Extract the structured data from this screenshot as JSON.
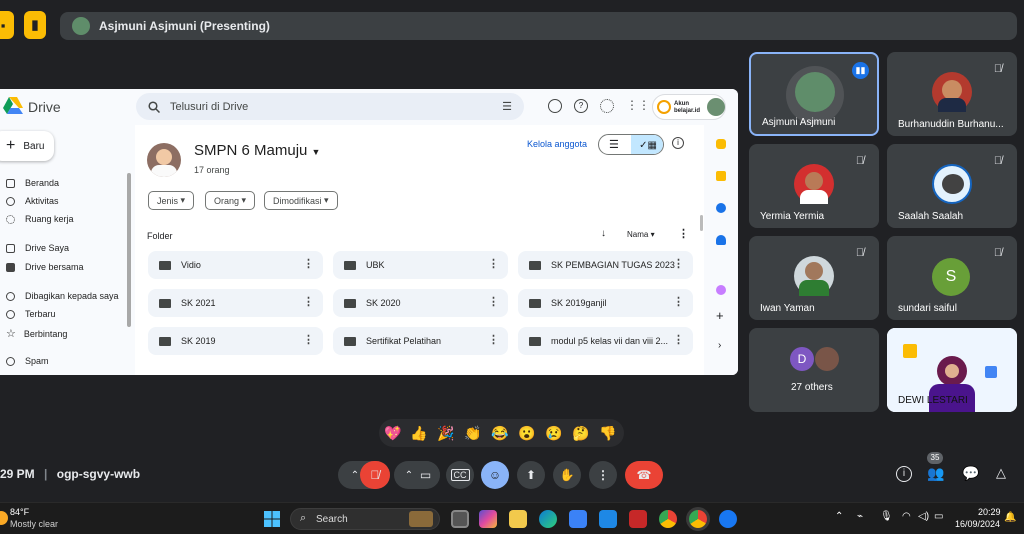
{
  "presenting_bar": {
    "text": "Asjmuni Asjmuni (Presenting)"
  },
  "drive": {
    "logo_text": "Drive",
    "search_placeholder": "Telusuri di Drive",
    "account_label": "Akun belajar.id",
    "new_button": "Baru",
    "nav": [
      "Beranda",
      "Aktivitas",
      "Ruang kerja",
      "Drive Saya",
      "Drive bersama",
      "Dibagikan kepada saya",
      "Terbaru",
      "Berbintang",
      "Spam"
    ],
    "drive_name": "SMPN 6 Mamuju",
    "members": "17 orang",
    "manage_members": "Kelola anggota",
    "filters": [
      "Jenis",
      "Orang",
      "Dimodifikasi"
    ],
    "section": "Folder",
    "sort_label": "Nama",
    "folders": [
      "Vidio",
      "UBK",
      "SK PEMBAGIAN TUGAS 2023",
      "SK 2021",
      "SK 2020",
      "SK 2019ganjil",
      "SK 2019",
      "Sertifikat Pelatihan",
      "modul p5 kelas vii dan viii 2..."
    ]
  },
  "participants": [
    {
      "name": "Asjmuni Asjmuni",
      "speaking": true
    },
    {
      "name": "Burhanuddin Burhanu...",
      "muted": true
    },
    {
      "name": "Yermia Yermia",
      "muted": true
    },
    {
      "name": "Saalah Saalah",
      "muted": true
    },
    {
      "name": "Iwan Yaman",
      "muted": true
    },
    {
      "name": "sundari saiful",
      "muted": true,
      "initial": "S"
    },
    {
      "name": "27 others",
      "initial": "D"
    },
    {
      "name": "DEWI LESTARI"
    }
  ],
  "reactions": [
    "💖",
    "👍",
    "🎉",
    "👏",
    "😂",
    "😮",
    "😢",
    "🤔",
    "👎"
  ],
  "meeting": {
    "time": "29 PM",
    "code": "ogp-sgvy-wwb",
    "participant_count": "35"
  },
  "taskbar": {
    "weather_temp": "84°F",
    "weather_desc": "Mostly clear",
    "search": "Search",
    "clock_time": "20:29",
    "clock_date": "16/09/2024"
  },
  "colors": {
    "accent_blue": "#8ab4f8",
    "end_call_red": "#ea4335",
    "tile_bg": "#3c4043"
  }
}
